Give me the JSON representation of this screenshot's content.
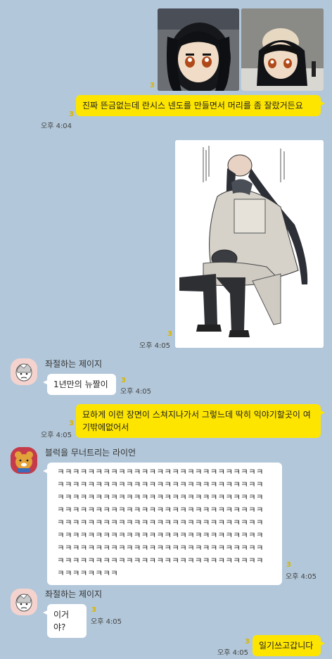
{
  "messages": {
    "m1_unread": "3",
    "m2_text": "진짜 뜬금없는데 란시스 넨도를 만들면서 머리를 좀 잘랐거든요",
    "m2_unread": "3",
    "m2_time": "오후 4:04",
    "m3_unread": "3",
    "m3_time": "오후 4:05",
    "m4_sender": "좌절하는 제이지",
    "m4_text": "1년만의 뉴짤이",
    "m4_unread": "3",
    "m4_time": "오후 4:05",
    "m5_text": "묘하게 이런 장면이 스쳐지나가서 그렇느데 딱히 익야기할곳이 여기밖에없어서",
    "m5_unread": "3",
    "m5_time": "오후 4:05",
    "m6_sender": "블럭을 무너트리는 라이언",
    "m6_lines": [
      "ㅋㅋㅋㅋㅋㅋㅋㅋㅋㅋㅋㅋㅋㅋㅋㅋㅋㅋㅋㅋㅋㅋㅋㅋㅋㅋㅋ",
      "ㅋㅋㅋㅋㅋㅋㅋㅋㅋㅋㅋㅋㅋㅋㅋㅋㅋㅋㅋㅋㅋㅋㅋㅋㅋㅋㅋ",
      "ㅋㅋㅋㅋㅋㅋㅋㅋㅋㅋㅋㅋㅋㅋㅋㅋㅋㅋㅋㅋㅋㅋㅋㅋㅋㅋㅋ",
      "ㅋㅋㅋㅋㅋㅋㅋㅋㅋㅋㅋㅋㅋㅋㅋㅋㅋㅋㅋㅋㅋㅋㅋㅋㅋㅋㅋ",
      "ㅋㅋㅋㅋㅋㅋㅋㅋㅋㅋㅋㅋㅋㅋㅋㅋㅋㅋㅋㅋㅋㅋㅋㅋㅋㅋㅋ",
      "ㅋㅋㅋㅋㅋㅋㅋㅋㅋㅋㅋㅋㅋㅋㅋㅋㅋㅋㅋㅋㅋㅋㅋㅋㅋㅋㅋ",
      "ㅋㅋㅋㅋㅋㅋㅋㅋㅋㅋㅋㅋㅋㅋㅋㅋㅋㅋㅋㅋㅋㅋㅋㅋㅋㅋㅋ",
      "ㅋㅋㅋㅋㅋㅋㅋㅋㅋㅋㅋㅋㅋㅋㅋㅋㅋㅋㅋㅋㅋㅋㅋㅋㅋㅋㅋ",
      "ㅋㅋㅋㅋㅋㅋㅋㅋ"
    ],
    "m6_unread": "3",
    "m6_time": "오후 4:05",
    "m7_sender": "좌절하는 제이지",
    "m7_text": "이거야?",
    "m7_unread": "3",
    "m7_time": "오후 4:05",
    "m8_text": "일기쓰고갑니다",
    "m8_unread": "3",
    "m8_time": "오후 4:05"
  },
  "colors": {
    "background": "#b2c7d9",
    "my_bubble": "#fee500",
    "other_bubble": "#ffffff",
    "unread": "#d8b500"
  },
  "icons": {
    "avatar_jayg": "jayg-avatar-icon",
    "avatar_ryan": "ryan-avatar-icon"
  }
}
